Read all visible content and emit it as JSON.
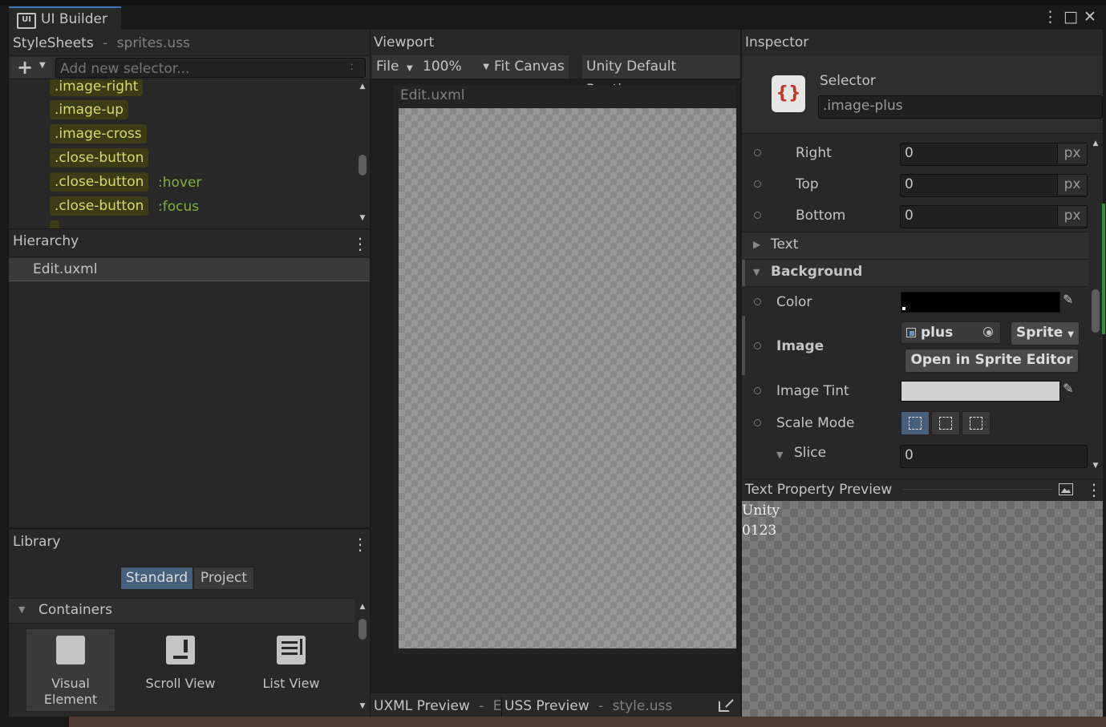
{
  "window": {
    "tab_title": "UI Builder",
    "tab_icon": "UI",
    "menu_icon": "⋮",
    "maximize_icon": "□",
    "close_icon": "✕"
  },
  "stylesheets": {
    "title": "StyleSheets",
    "separator": "-",
    "file": "sprites.uss",
    "add_icon": "+",
    "selector_placeholder": "Add new selector...",
    "items": [
      {
        "selector": ".image-right",
        "pseudo": ""
      },
      {
        "selector": ".image-up",
        "pseudo": ""
      },
      {
        "selector": ".image-cross",
        "pseudo": ""
      },
      {
        "selector": ".close-button",
        "pseudo": ""
      },
      {
        "selector": ".close-button",
        "pseudo": ":hover"
      },
      {
        "selector": ".close-button",
        "pseudo": ":focus"
      }
    ]
  },
  "hierarchy": {
    "title": "Hierarchy",
    "root": "Edit.uxml"
  },
  "library": {
    "title": "Library",
    "tabs": [
      "Standard",
      "Project"
    ],
    "active_tab": "Standard",
    "section": "Containers",
    "items": [
      {
        "label1": "Visual",
        "label2": "Element",
        "icon": "visual-element-icon"
      },
      {
        "label1": "Scroll View",
        "label2": "",
        "icon": "scroll-view-icon"
      },
      {
        "label1": "List View",
        "label2": "",
        "icon": "list-view-icon"
      }
    ]
  },
  "viewport": {
    "title": "Viewport",
    "file_menu": "File",
    "zoom": "100%",
    "fit_canvas": "Fit Canvas",
    "theme": "Unity Default Runtime",
    "canvas_title": "Edit.uxml",
    "bottom_tabs": {
      "uxml_label": "UXML Preview",
      "uxml_sep": "-",
      "uxml_trunc": "E",
      "uss_label": "USS Preview",
      "uss_sep": "-",
      "uss_file": "style.uss"
    }
  },
  "inspector": {
    "title": "Inspector",
    "selector_label": "Selector",
    "selector_value": ".image-plus",
    "position_rows": [
      {
        "label": "Right",
        "value": "0",
        "unit": "px"
      },
      {
        "label": "Top",
        "value": "0",
        "unit": "px"
      },
      {
        "label": "Bottom",
        "value": "0",
        "unit": "px"
      }
    ],
    "text_section": "Text",
    "background_section": "Background",
    "color_label": "Color",
    "color_value": "#000000",
    "image_label": "Image",
    "image_value": "plus",
    "image_type": "Sprite",
    "open_sprite_editor": "Open in Sprite Editor",
    "tint_label": "Image Tint",
    "tint_value": "#d2d2d2",
    "scale_mode_label": "Scale Mode",
    "slice_label": "Slice",
    "slice_value": "0"
  },
  "text_preview": {
    "title": "Text Property Preview",
    "line1": "Unity",
    "line2": "0123"
  },
  "colors": {
    "selector_chip": "#3c3c16",
    "pseudo_class": "#7fb23a",
    "accent": "#3a79bb",
    "active_segment": "#46607c"
  }
}
